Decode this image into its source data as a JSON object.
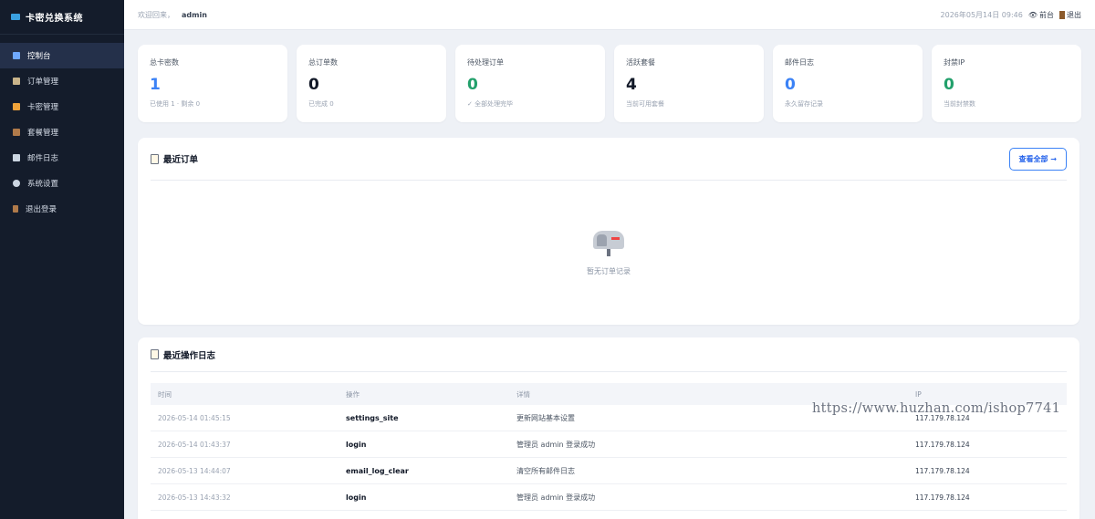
{
  "sidebar": {
    "brand": "卡密兑换系统",
    "items": [
      {
        "label": "控制台",
        "icon": "chart-icon",
        "color": "#6ea8fe"
      },
      {
        "label": "订单管理",
        "icon": "clipboard-icon",
        "color": "#c9b48a"
      },
      {
        "label": "卡密管理",
        "icon": "key-icon",
        "color": "#f0a33a"
      },
      {
        "label": "套餐管理",
        "icon": "package-icon",
        "color": "#b07a4a"
      },
      {
        "label": "邮件日志",
        "icon": "mail-icon",
        "color": "#cbd5e1"
      },
      {
        "label": "系统设置",
        "icon": "gear-icon",
        "color": "#cbd5e1"
      },
      {
        "label": "退出登录",
        "icon": "door-icon",
        "color": "#b07a4a"
      }
    ]
  },
  "topbar": {
    "welcome": "欢迎回来，",
    "username": "admin",
    "datetime": "2026年05月14日 09:46",
    "frontend_label": "前台",
    "logout_label": "退出"
  },
  "stats": [
    {
      "title": "总卡密数",
      "value": "1",
      "sub": "已使用 1 · 剩余 0",
      "color": "#3b82f6"
    },
    {
      "title": "总订单数",
      "value": "0",
      "sub": "已完成 0",
      "color": "#111827"
    },
    {
      "title": "待处理订单",
      "value": "0",
      "sub": "✓ 全部处理完毕",
      "color": "#22a06b"
    },
    {
      "title": "活跃套餐",
      "value": "4",
      "sub": "当前可用套餐",
      "color": "#111827"
    },
    {
      "title": "邮件日志",
      "value": "0",
      "sub": "永久留存记录",
      "color": "#3b82f6"
    },
    {
      "title": "封禁IP",
      "value": "0",
      "sub": "当前封禁数",
      "color": "#22a06b"
    }
  ],
  "recent_orders": {
    "title": "最近订单",
    "view_all": "查看全部 →",
    "empty_text": "暂无订单记录"
  },
  "recent_logs": {
    "title": "最近操作日志",
    "columns": [
      "时间",
      "操作",
      "详情",
      "IP"
    ],
    "rows": [
      {
        "time": "2026-05-14 01:45:15",
        "action": "settings_site",
        "detail": "更新网站基本设置",
        "ip": "117.179.78.124"
      },
      {
        "time": "2026-05-14 01:43:37",
        "action": "login",
        "detail": "管理员 admin 登录成功",
        "ip": "117.179.78.124"
      },
      {
        "time": "2026-05-13 14:44:07",
        "action": "email_log_clear",
        "detail": "清空所有邮件日志",
        "ip": "117.179.78.124"
      },
      {
        "time": "2026-05-13 14:43:32",
        "action": "login",
        "detail": "管理员 admin 登录成功",
        "ip": "117.179.78.124"
      }
    ]
  },
  "watermark": "https://www.huzhan.com/ishop7741"
}
